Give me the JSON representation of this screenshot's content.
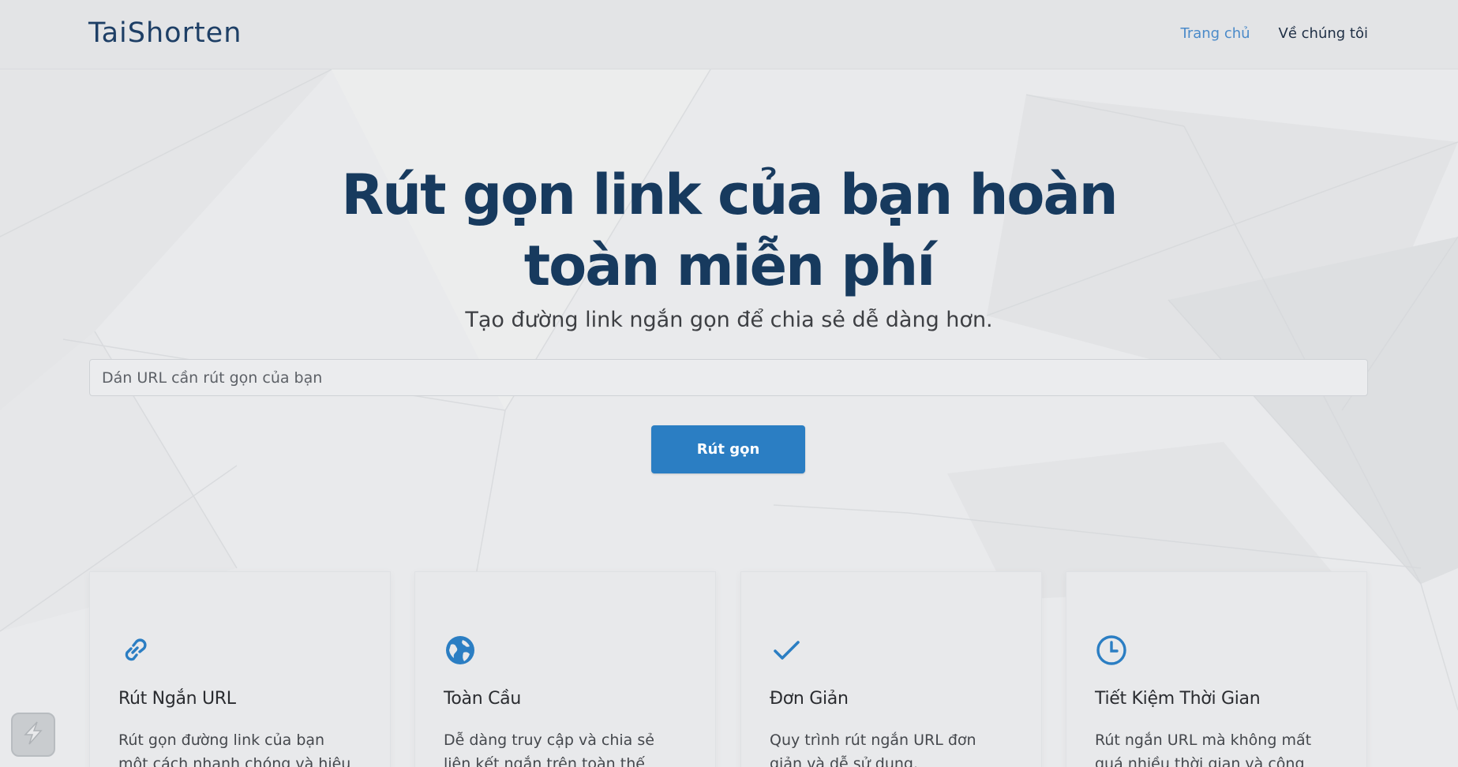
{
  "header": {
    "brand": "TaiShorten",
    "nav": [
      {
        "label": "Trang chủ",
        "active": true
      },
      {
        "label": "Về chúng tôi",
        "active": false
      }
    ]
  },
  "hero": {
    "title_line1": "Rút gọn link của bạn hoàn",
    "title_line2": "toàn miễn phí",
    "subtitle": "Tạo đường link ngắn gọn để chia sẻ dễ dàng hơn.",
    "input_placeholder": "Dán URL cần rút gọn của bạn",
    "input_value": "",
    "button_label": "Rút gọn"
  },
  "features": [
    {
      "icon": "link-icon",
      "title": "Rút Ngắn URL",
      "description": "Rút gọn đường link của bạn một cách nhanh chóng và hiệu quả."
    },
    {
      "icon": "globe-icon",
      "title": "Toàn Cầu",
      "description": "Dễ dàng truy cập và chia sẻ liên kết ngắn trên toàn thế giới."
    },
    {
      "icon": "check-icon",
      "title": "Đơn Giản",
      "description": "Quy trình rút ngắn URL đơn giản và dễ sử dụng."
    },
    {
      "icon": "clock-icon",
      "title": "Tiết Kiệm Thời Gian",
      "description": "Rút ngắn URL mà không mất quá nhiều thời gian và công sức."
    }
  ],
  "colors": {
    "accent": "#2b7ec3",
    "title": "#173a5e",
    "nav_active": "#4a8ac9",
    "background": "#e9eaec"
  },
  "widget": {
    "icon": "lightning-icon"
  }
}
